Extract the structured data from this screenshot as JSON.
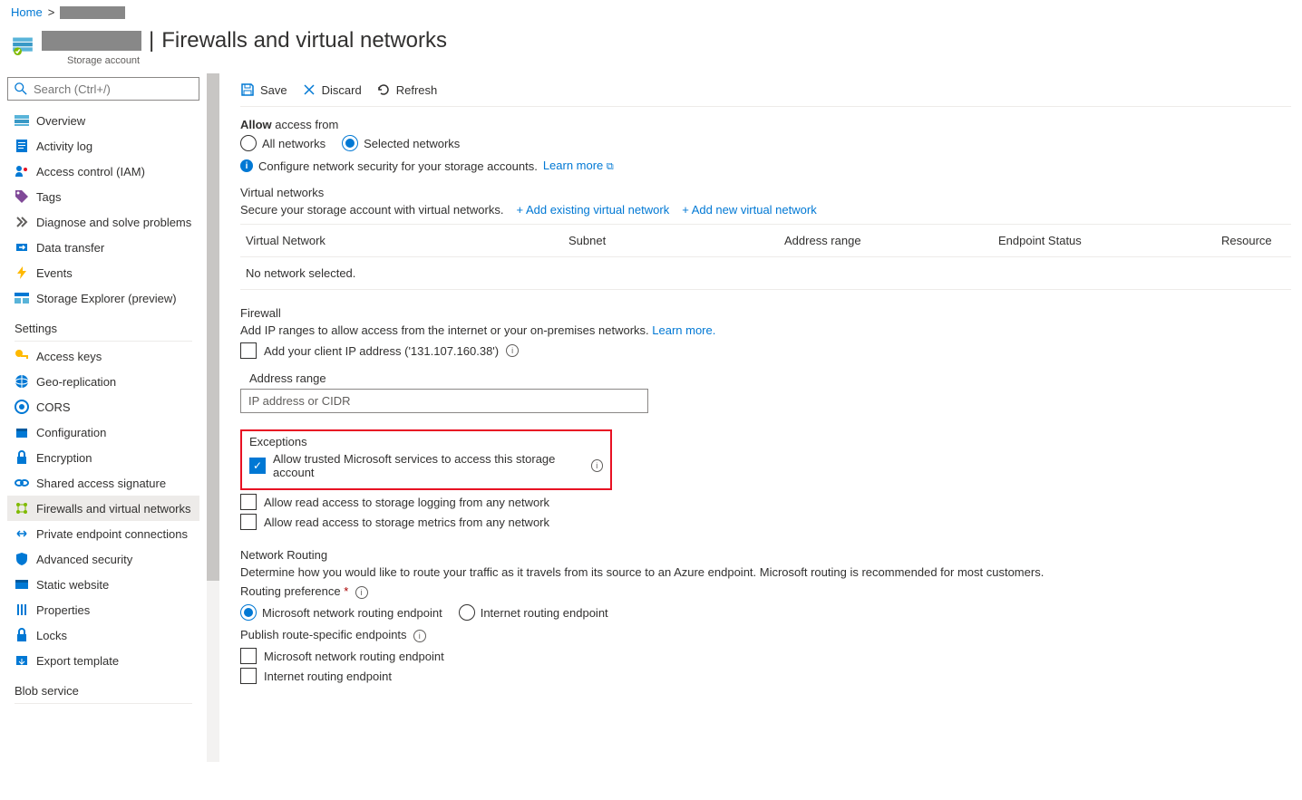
{
  "breadcrumb": {
    "home": "Home"
  },
  "header": {
    "title": "Firewalls and virtual networks",
    "subtitle": "Storage account"
  },
  "search": {
    "placeholder": "Search (Ctrl+/)"
  },
  "nav": {
    "items": [
      {
        "label": "Overview"
      },
      {
        "label": "Activity log"
      },
      {
        "label": "Access control (IAM)"
      },
      {
        "label": "Tags"
      },
      {
        "label": "Diagnose and solve problems"
      },
      {
        "label": "Data transfer"
      },
      {
        "label": "Events"
      },
      {
        "label": "Storage Explorer (preview)"
      }
    ],
    "settings_label": "Settings",
    "settings": [
      {
        "label": "Access keys"
      },
      {
        "label": "Geo-replication"
      },
      {
        "label": "CORS"
      },
      {
        "label": "Configuration"
      },
      {
        "label": "Encryption"
      },
      {
        "label": "Shared access signature"
      },
      {
        "label": "Firewalls and virtual networks"
      },
      {
        "label": "Private endpoint connections"
      },
      {
        "label": "Advanced security"
      },
      {
        "label": "Static website"
      },
      {
        "label": "Properties"
      },
      {
        "label": "Locks"
      },
      {
        "label": "Export template"
      }
    ],
    "blob_label": "Blob service"
  },
  "toolbar": {
    "save": "Save",
    "discard": "Discard",
    "refresh": "Refresh"
  },
  "access": {
    "label": "Allow access from",
    "all": "All networks",
    "selected": "Selected networks",
    "info": "Configure network security for your storage accounts.",
    "learn": "Learn more"
  },
  "vn": {
    "title": "Virtual networks",
    "desc": "Secure your storage account with virtual networks.",
    "add_existing": "+ Add existing virtual network",
    "add_new": "+ Add new virtual network",
    "cols": {
      "c1": "Virtual Network",
      "c2": "Subnet",
      "c3": "Address range",
      "c4": "Endpoint Status",
      "c5": "Resource"
    },
    "empty": "No network selected."
  },
  "fw": {
    "title": "Firewall",
    "desc": "Add IP ranges to allow access from the internet or your on-premises networks.",
    "learn": "Learn more.",
    "add_ip": "Add your client IP address ('131.107.160.38')",
    "range_label": "Address range",
    "placeholder": "IP address or CIDR"
  },
  "exc": {
    "title": "Exceptions",
    "trusted": "Allow trusted Microsoft services to access this storage account",
    "logging": "Allow read access to storage logging from any network",
    "metrics": "Allow read access to storage metrics from any network"
  },
  "routing": {
    "title": "Network Routing",
    "desc": "Determine how you would like to route your traffic as it travels from its source to an Azure endpoint. Microsoft routing is recommended for most customers.",
    "pref_label": "Routing preference",
    "ms": "Microsoft network routing endpoint",
    "internet": "Internet routing endpoint",
    "publish_label": "Publish route-specific endpoints",
    "pub_ms": "Microsoft network routing endpoint",
    "pub_internet": "Internet routing endpoint"
  }
}
